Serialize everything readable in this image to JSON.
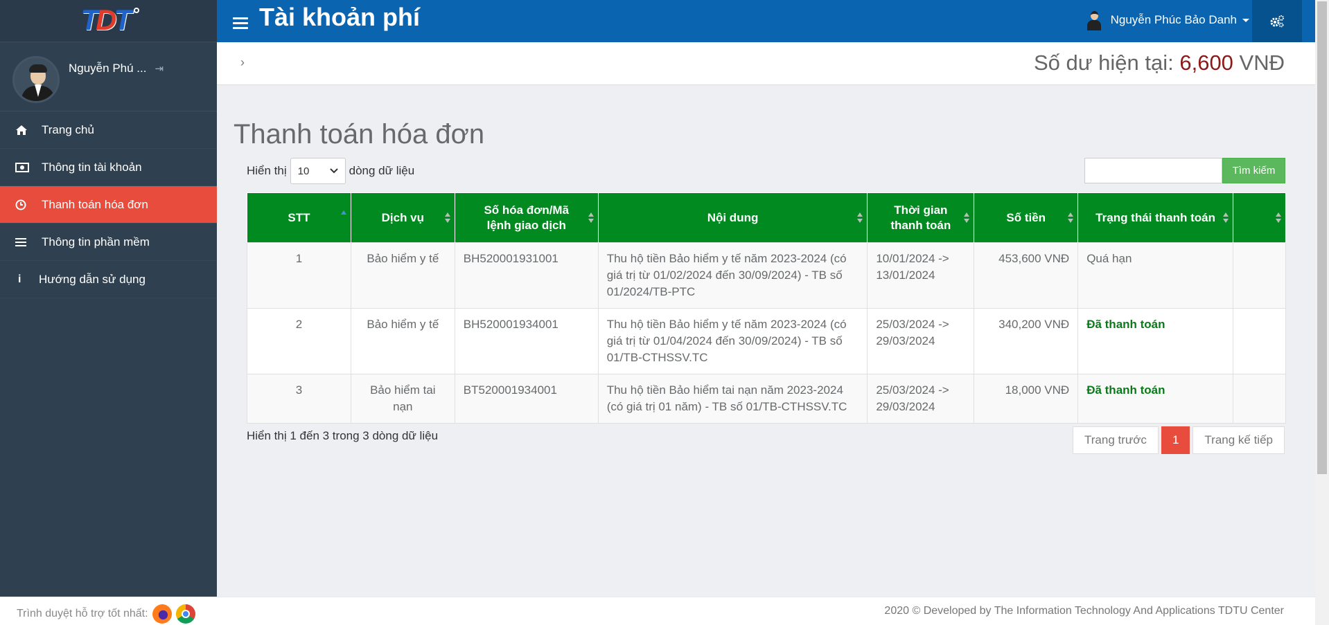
{
  "sidebar": {
    "profile_name": "Nguyễn Phú ...",
    "items": [
      {
        "label": "Trang chủ",
        "icon": "home-icon"
      },
      {
        "label": "Thông tin tài khoản",
        "icon": "money-icon"
      },
      {
        "label": "Thanh toán hóa đơn",
        "icon": "clock-icon",
        "active": true
      },
      {
        "label": "Thông tin phần mềm",
        "icon": "list-icon"
      },
      {
        "label": "Hướng dẫn sử dụng",
        "icon": "info-icon"
      }
    ]
  },
  "header": {
    "title": "Tài khoản phí",
    "user_name": "Nguyễn Phúc Bảo Danh",
    "settings_icon": "gears-icon"
  },
  "subbar": {
    "balance_label": "Số dư hiện tại:",
    "balance_amount": "6,600",
    "balance_currency": "VNĐ"
  },
  "main": {
    "title": "Thanh toán hóa đơn",
    "length_prefix": "Hiển thị",
    "length_value": "10",
    "length_suffix": "dòng dữ liệu",
    "search_button": "Tìm kiếm",
    "columns": [
      "STT",
      "Dịch vụ",
      "Số hóa đơn/Mã lệnh giao dịch",
      "Nội dung",
      "Thời gian thanh toán",
      "Số tiền",
      "Trạng thái thanh toán",
      ""
    ],
    "rows": [
      {
        "stt": "1",
        "service": "Bảo hiểm y tế",
        "invoice": "BH520001931001",
        "content": "Thu hộ tiền Bảo hiểm y tế năm 2023-2024 (có giá trị từ 01/02/2024 đến 30/09/2024) - TB số 01/2024/TB-PTC",
        "time": "10/01/2024 -> 13/01/2024",
        "amount": "453,600 VNĐ",
        "status": "Quá hạn",
        "paid": false
      },
      {
        "stt": "2",
        "service": "Bảo hiểm y tế",
        "invoice": "BH520001934001",
        "content": "Thu hộ tiền Bảo hiểm y tế năm 2023-2024 (có giá trị từ 01/04/2024 đến 30/09/2024) - TB số 01/TB-CTHSSV.TC",
        "time": "25/03/2024 -> 29/03/2024",
        "amount": "340,200 VNĐ",
        "status": "Đã thanh toán",
        "paid": true
      },
      {
        "stt": "3",
        "service": "Bảo hiểm tai nạn",
        "invoice": "BT520001934001",
        "content": "Thu hộ tiền Bảo hiểm tai nạn năm 2023-2024 (có giá trị 01 năm) - TB số 01/TB-CTHSSV.TC",
        "time": "25/03/2024 -> 29/03/2024",
        "amount": "18,000 VNĐ",
        "status": "Đã thanh toán",
        "paid": true
      }
    ],
    "info": "Hiển thị 1 đến 3 trong 3 dòng dữ liệu",
    "pagination": {
      "prev": "Trang trước",
      "current": "1",
      "next": "Trang kế tiếp"
    }
  },
  "footer": {
    "browsers_label": "Trình duyệt hỗ trợ tốt nhất:",
    "copyright": "2020 © Developed by The Information Technology And Applications TDTU Center"
  },
  "colors": {
    "sidebar": "#2f4050",
    "topbar": "#0a64b0",
    "active": "#e74c3c",
    "table_header": "#008a1f",
    "paid": "#0a7a1a",
    "balance": "#8b1a1a"
  }
}
